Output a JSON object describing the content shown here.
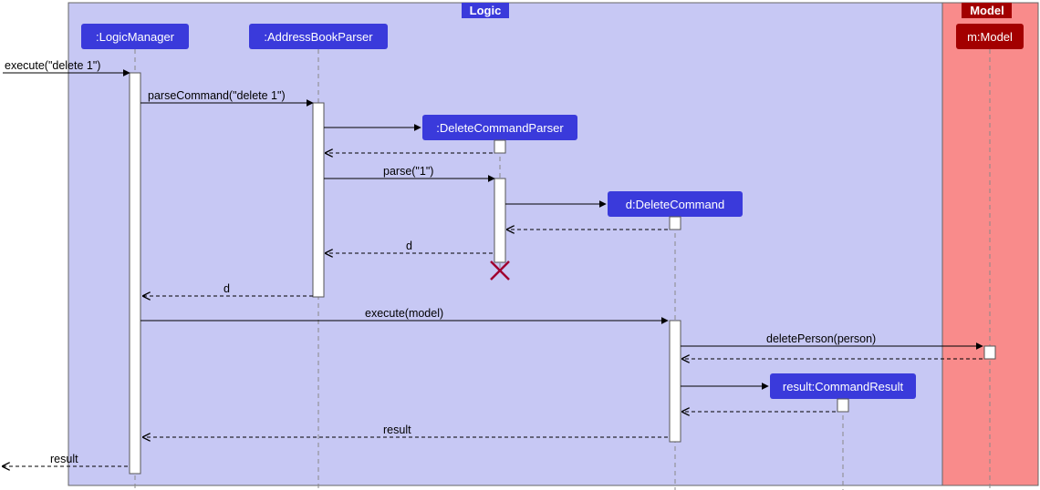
{
  "frames": {
    "logic": {
      "title": "Logic"
    },
    "model": {
      "title": "Model"
    }
  },
  "participants": {
    "logicManager": ":LogicManager",
    "addressBookParser": ":AddressBookParser",
    "deleteCommandParser": ":DeleteCommandParser",
    "deleteCommand": "d:DeleteCommand",
    "commandResult": "result:CommandResult",
    "model": "m:Model"
  },
  "messages": {
    "execute_in": "execute(\"delete 1\")",
    "parseCommand": "parseCommand(\"delete 1\")",
    "parse1": "parse(\"1\")",
    "return_d1": "d",
    "return_d2": "d",
    "executeModel": "execute(model)",
    "deletePerson": "deletePerson(person)",
    "return_result1": "result",
    "return_result_out": "result"
  }
}
